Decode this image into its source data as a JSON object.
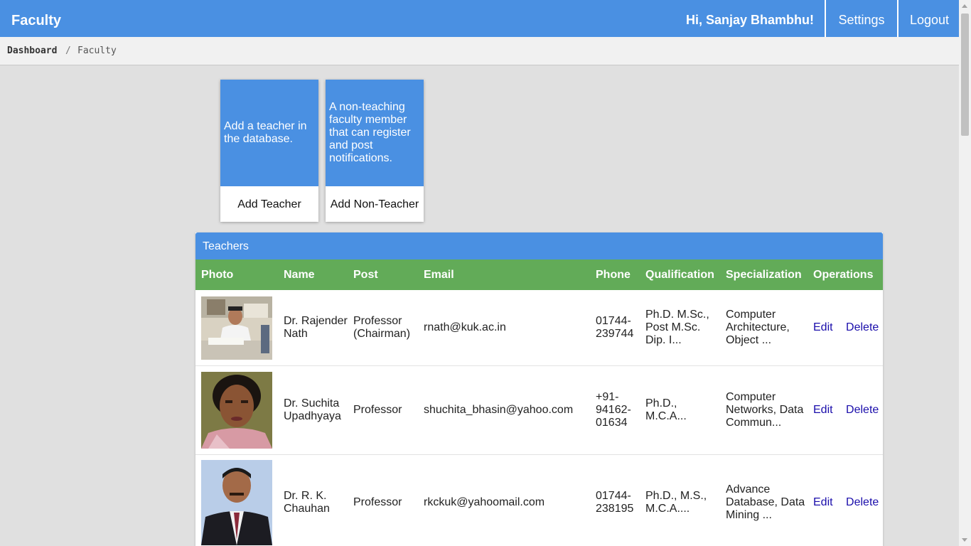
{
  "header": {
    "brand": "Faculty",
    "greeting": "Hi, Sanjay Bhambhu!",
    "settings": "Settings",
    "logout": "Logout",
    "color": "#4a90e2"
  },
  "breadcrumb": {
    "home": "Dashboard",
    "separator": "/",
    "current": "Faculty"
  },
  "cards": [
    {
      "description": "Add a teacher in the database.",
      "button": "Add Teacher"
    },
    {
      "description": "A non-teaching faculty member that can register and post notifications.",
      "button": "Add Non-Teacher"
    }
  ],
  "teachers": {
    "title": "Teachers",
    "header_color": "#62ab58",
    "columns": [
      "Photo",
      "Name",
      "Post",
      "Email",
      "Phone",
      "Qualification",
      "Specialization",
      "Operations"
    ],
    "rows": [
      {
        "name": "Dr. Rajender Nath",
        "post": "Professor (Chairman)",
        "email": "rnath@kuk.ac.in",
        "phone": "01744-239744",
        "qualification": "Ph.D. M.Sc., Post M.Sc. Dip. I...",
        "specialization": "Computer Architecture, Object ...",
        "edit": "Edit",
        "delete": "Delete"
      },
      {
        "name": "Dr. Suchita Upadhyaya",
        "post": "Professor",
        "email": "shuchita_bhasin@yahoo.com",
        "phone": "+91-94162-01634",
        "qualification": "Ph.D., M.C.A...",
        "specialization": "Computer Networks, Data Commun...",
        "edit": "Edit",
        "delete": "Delete"
      },
      {
        "name": "Dr. R. K. Chauhan",
        "post": "Professor",
        "email": "rkckuk@yahoomail.com",
        "phone": "01744-238195",
        "qualification": "Ph.D., M.S., M.C.A....",
        "specialization": "Advance Database, Data Mining ...",
        "edit": "Edit",
        "delete": "Delete"
      }
    ]
  }
}
